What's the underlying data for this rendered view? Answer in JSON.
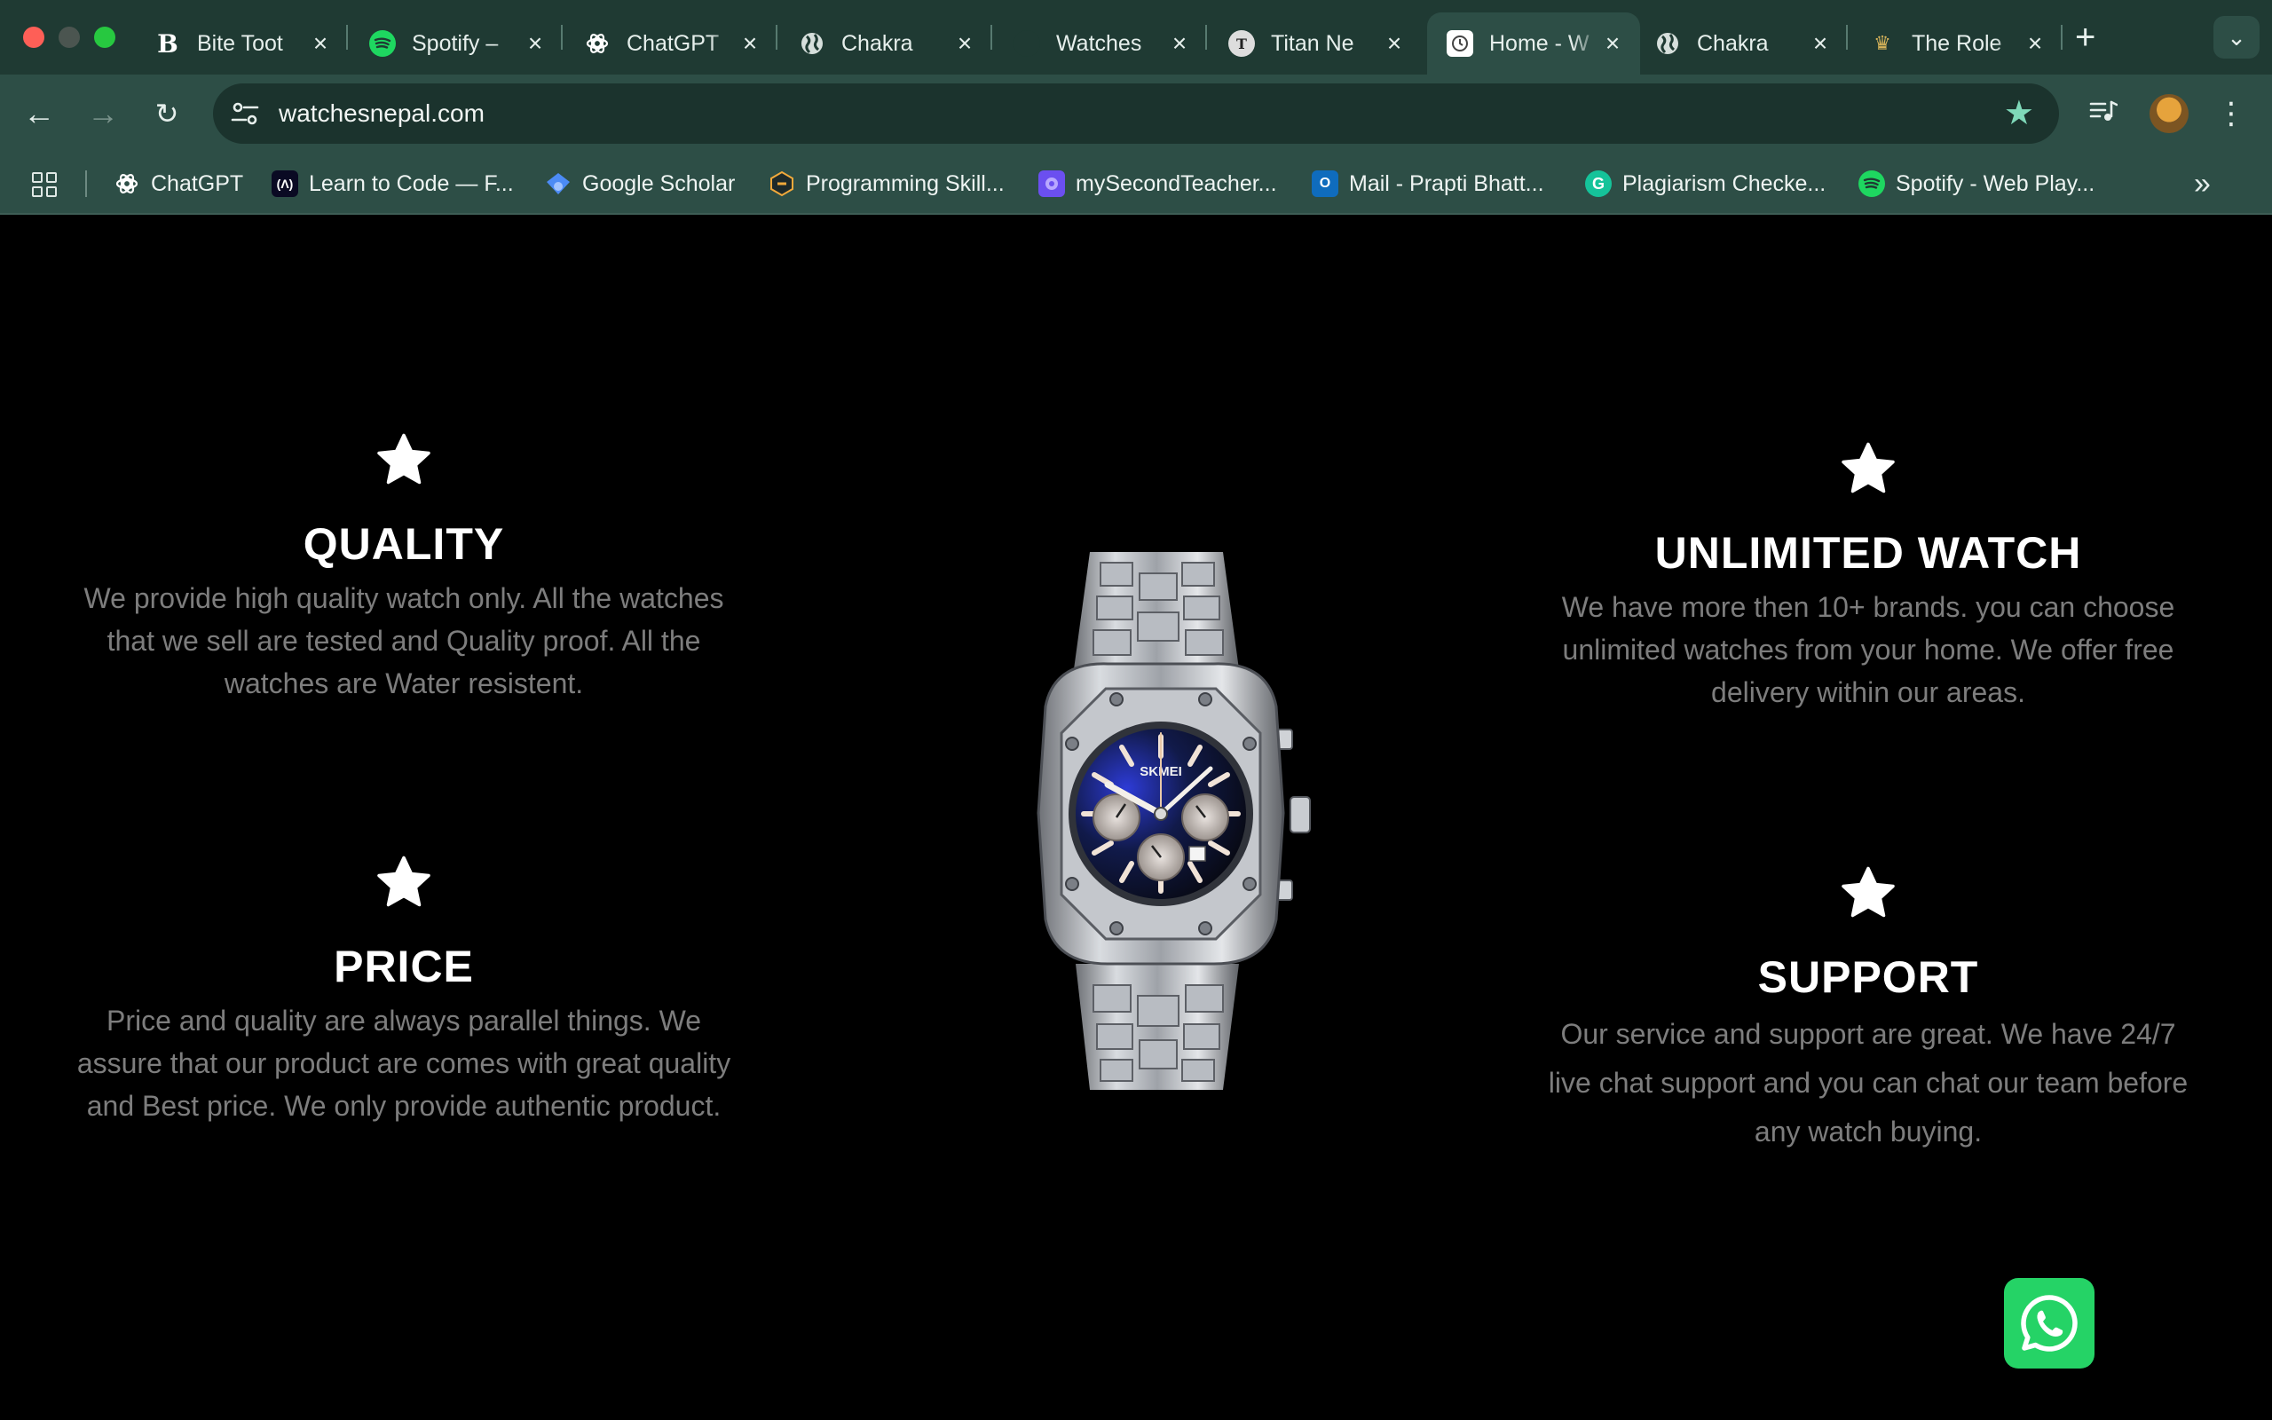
{
  "browser": {
    "tabs": [
      {
        "title": "Bite Toot",
        "icon": "bold-b-icon",
        "active": false
      },
      {
        "title": "Spotify –",
        "icon": "spotify-icon",
        "active": false
      },
      {
        "title": "ChatGPT",
        "icon": "chatgpt-icon",
        "active": false
      },
      {
        "title": "Chakra",
        "icon": "globe-icon",
        "active": false
      },
      {
        "title": "Watches",
        "icon": "blank-favicon",
        "active": false
      },
      {
        "title": "Titan Ne",
        "icon": "titan-icon",
        "active": false
      },
      {
        "title": "Home - W",
        "icon": "clock-icon",
        "active": true
      },
      {
        "title": "Chakra",
        "icon": "globe-icon",
        "active": false
      },
      {
        "title": "The Role",
        "icon": "crown-icon",
        "active": false
      }
    ],
    "url": "watchesnepal.com",
    "bookmarked": true,
    "bookmarks": [
      {
        "label": "ChatGPT",
        "icon": "chatgpt-icon"
      },
      {
        "label": "Learn to Code — F...",
        "icon": "freecodecamp-icon"
      },
      {
        "label": "Google Scholar",
        "icon": "scholar-icon"
      },
      {
        "label": "Programming Skill...",
        "icon": "hackerrank-icon"
      },
      {
        "label": "mySecondTeacher...",
        "icon": "mysecondteacher-icon"
      },
      {
        "label": "Mail - Prapti Bhatt...",
        "icon": "outlook-icon"
      },
      {
        "label": "Plagiarism Checke...",
        "icon": "grammarly-icon"
      },
      {
        "label": "Spotify - Web Play...",
        "icon": "spotify-icon"
      }
    ],
    "colors": {
      "frame": "#1f3a33",
      "toolbar": "#2d4e46",
      "accent_star": "#7fd9b9"
    }
  },
  "features": {
    "quality": {
      "title": "QUALITY",
      "text": "We provide high quality watch only. All the watches that we sell are tested and Quality proof. All the watches are Water resistent."
    },
    "price": {
      "title": "PRICE",
      "text": "Price and quality are always parallel things. We assure that our product are comes with great quality and Best price. We only provide authentic product."
    },
    "unlimited": {
      "title": "UNLIMITED WATCH",
      "text": "We have more then 10+ brands. you can choose unlimited watches from your home. We offer free delivery within our areas."
    },
    "support": {
      "title": "SUPPORT",
      "text": "Our service and support are great. We have 24/7 live chat support and you can chat our team before any watch buying."
    }
  },
  "watch": {
    "brand": "SKMEI"
  },
  "floating": {
    "whatsapp_color": "#25d366"
  }
}
